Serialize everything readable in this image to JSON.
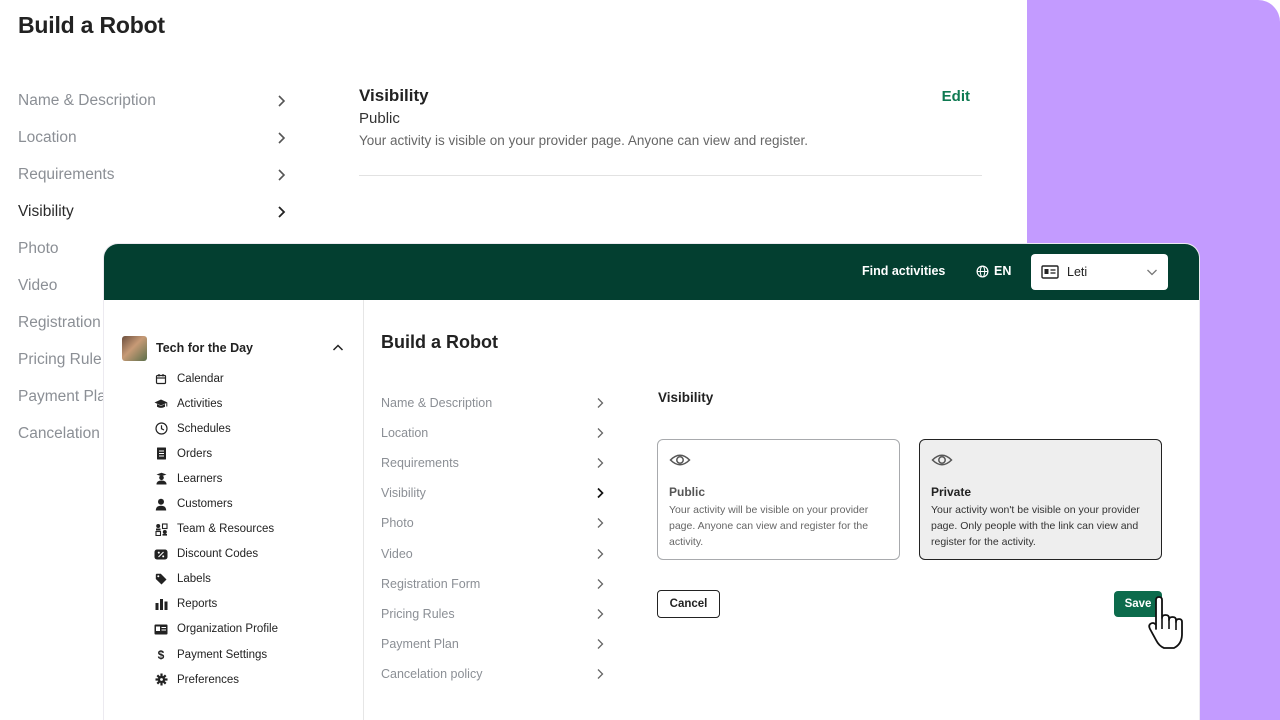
{
  "background": {
    "title": "Build a Robot",
    "nav": [
      {
        "label": "Name & Description"
      },
      {
        "label": "Location"
      },
      {
        "label": "Requirements"
      },
      {
        "label": "Visibility"
      },
      {
        "label": "Photo"
      },
      {
        "label": "Video"
      },
      {
        "label": "Registration"
      },
      {
        "label": "Pricing Rule"
      },
      {
        "label": "Payment Pla"
      },
      {
        "label": "Cancelation"
      }
    ],
    "section": {
      "title": "Visibility",
      "edit_label": "Edit",
      "value": "Public",
      "description": "Your activity is visible on your provider page. Anyone can view and register."
    }
  },
  "topbar": {
    "find_activities": "Find activities",
    "language": "EN",
    "user": "Leti"
  },
  "sidebar": {
    "org_name": "Tech for the Day",
    "items": [
      {
        "label": "Calendar",
        "icon": "calendar-icon"
      },
      {
        "label": "Activities",
        "icon": "graduation-cap-icon"
      },
      {
        "label": "Schedules",
        "icon": "clock-icon"
      },
      {
        "label": "Orders",
        "icon": "receipt-icon"
      },
      {
        "label": "Learners",
        "icon": "learner-icon"
      },
      {
        "label": "Customers",
        "icon": "person-icon"
      },
      {
        "label": "Team & Resources",
        "icon": "team-icon"
      },
      {
        "label": "Discount Codes",
        "icon": "discount-icon"
      },
      {
        "label": "Labels",
        "icon": "tag-icon"
      },
      {
        "label": "Reports",
        "icon": "bar-chart-icon"
      },
      {
        "label": "Organization Profile",
        "icon": "id-card-icon"
      },
      {
        "label": "Payment Settings",
        "icon": "dollar-icon"
      },
      {
        "label": "Preferences",
        "icon": "gear-icon"
      }
    ]
  },
  "main": {
    "title": "Build a Robot",
    "nav": [
      {
        "label": "Name & Description"
      },
      {
        "label": "Location"
      },
      {
        "label": "Requirements"
      },
      {
        "label": "Visibility"
      },
      {
        "label": "Photo"
      },
      {
        "label": "Video"
      },
      {
        "label": "Registration Form"
      },
      {
        "label": "Pricing Rules"
      },
      {
        "label": "Payment Plan"
      },
      {
        "label": "Cancelation policy"
      }
    ],
    "visibility": {
      "title": "Visibility",
      "options": [
        {
          "name": "Public",
          "description": "Your activity will be visible on your provider page. Anyone can view and register for the activity."
        },
        {
          "name": "Private",
          "description": "Your activity won't be visible on your provider page. Only people with the link can view and register for the activity."
        }
      ],
      "selected": "Private"
    },
    "cancel_label": "Cancel",
    "save_label": "Save"
  },
  "colors": {
    "brand_dark_green": "#033f30",
    "save_green": "#0c6b4c",
    "edit_green": "#0f7a52",
    "accent_purple": "#c39bff"
  }
}
